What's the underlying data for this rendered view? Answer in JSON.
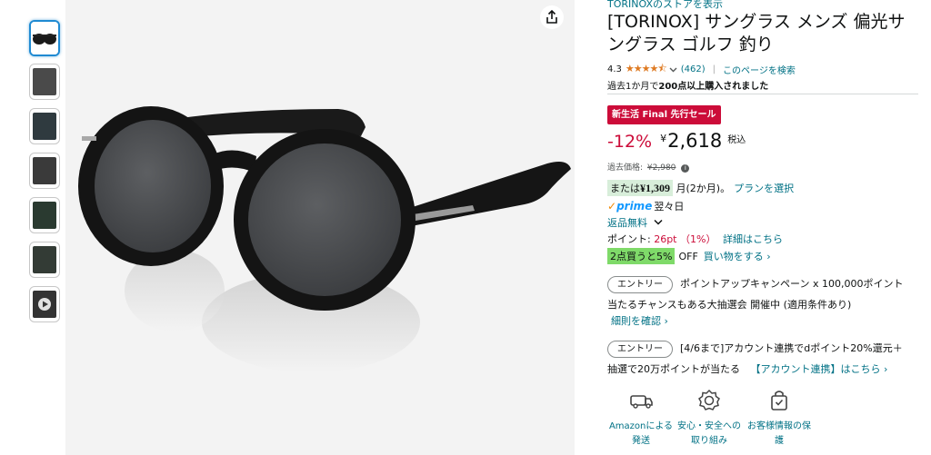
{
  "thumbnails": [
    {
      "name": "thumb-1",
      "kind": "glasses",
      "active": true
    },
    {
      "name": "thumb-2",
      "kind": "photo",
      "active": false
    },
    {
      "name": "thumb-3",
      "kind": "photo",
      "active": false
    },
    {
      "name": "thumb-4",
      "kind": "photo",
      "active": false
    },
    {
      "name": "thumb-5",
      "kind": "photo",
      "active": false
    },
    {
      "name": "thumb-6",
      "kind": "photo",
      "active": false
    },
    {
      "name": "thumb-7",
      "kind": "video",
      "active": false
    }
  ],
  "share_icon": "share-icon",
  "product": {
    "store_link": "TORINOXのストアを表示",
    "title": "[TORINOX] サングラス メンズ 偏光サングラス ゴルフ 釣り",
    "rating": "4.3",
    "stars": "★★★★⯪",
    "rating_count": "(462)",
    "separator": "|",
    "search_page": "このページを検索",
    "bought_prefix": "過去1か月で",
    "bought_bold": "200点以上購入されました"
  },
  "deal": {
    "badge": "新生活 Final 先行セール",
    "discount": "-12%",
    "currency": "¥",
    "price": "2,618",
    "tax": "税込",
    "list_label": "過去価格:",
    "list_price": "¥2,980",
    "info": "i"
  },
  "installment": {
    "prefix": "または",
    "amount": "¥1,309",
    "suffix": " 月(2か月)。",
    "link": "プランを選択"
  },
  "delivery": {
    "check": "✓",
    "prime": "prime",
    "label": "翌々日"
  },
  "returns": {
    "label": "返品無料"
  },
  "points": {
    "label": "ポイント: ",
    "value": "26pt （1%）",
    "link": "詳細はこちら"
  },
  "bulk": {
    "pill": "2点買うと5%",
    "off": "OFF",
    "link": "買い物をする ›"
  },
  "promos": [
    {
      "button": "エントリー",
      "line1": "ポイントアップキャンペーン x 100,000ポイント",
      "line2": "当たるチャンスもある大抽選会 開催中 (適用条件あり)",
      "link": "細則を確認 ›"
    },
    {
      "button": "エントリー",
      "line1": "[4/6まで]アカウント連携でdポイント20%還元＋",
      "line2": "抽選で20万ポイントが当たる",
      "link": "【アカウント連携】はこちら ›"
    }
  ],
  "trust_badges": [
    {
      "icon": "delivery-truck-icon",
      "line1": "Amazonによる",
      "line2": "発送"
    },
    {
      "icon": "safety-badge-icon",
      "line1": "安心・安全への",
      "line2": "取り組み"
    },
    {
      "icon": "shopping-bag-check-icon",
      "line1": "お客様情報の保",
      "line2": "護"
    }
  ],
  "colors": {
    "link": "#007185",
    "deal_red": "#cc0c39",
    "star": "#de7921",
    "prime_blue": "#1399ff",
    "bulk_green": "#7fda69",
    "installment_green": "#d8eeda"
  }
}
